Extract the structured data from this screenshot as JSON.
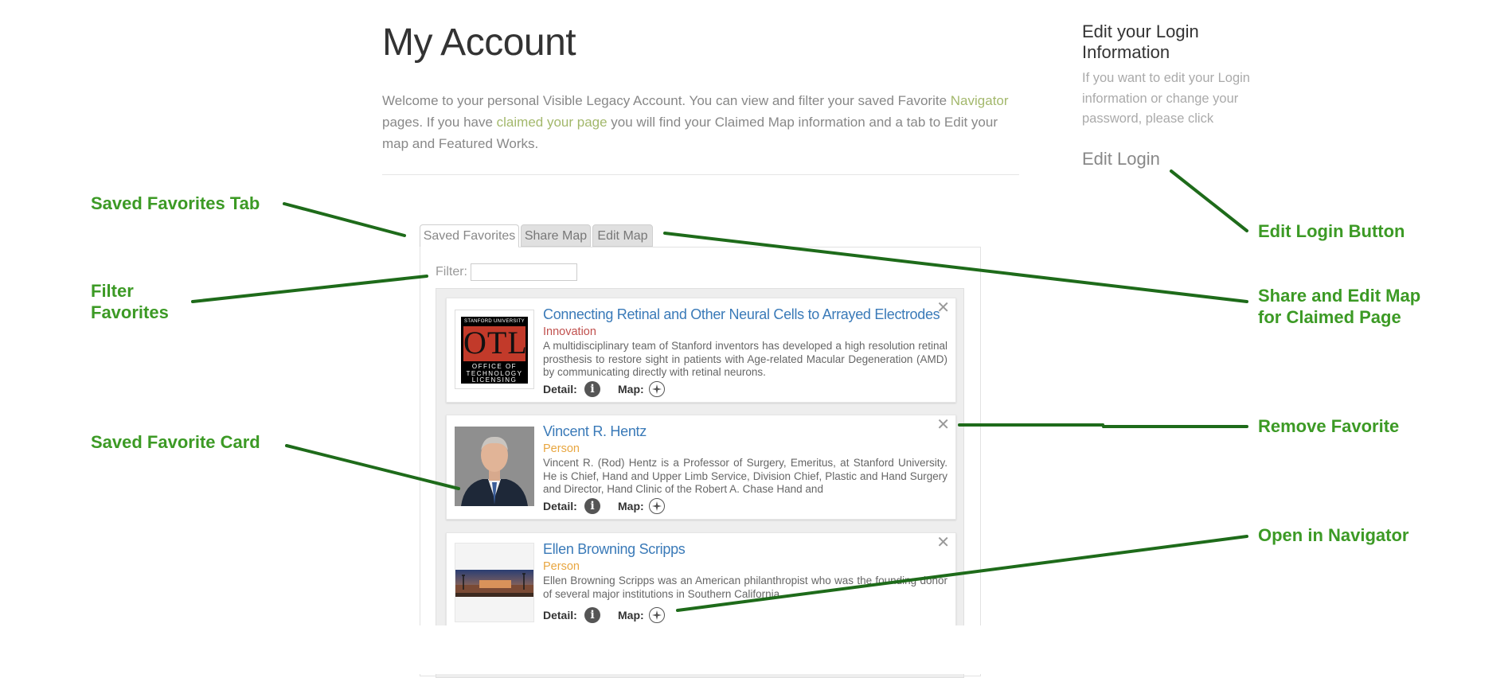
{
  "header": {
    "title": "My Account",
    "intro_part1": "Welcome to your personal Visible Legacy Account.  You can view and filter your saved Favorite ",
    "intro_link1": "Navigator",
    "intro_part2": " pages.  If you have ",
    "intro_link2": "claimed your page",
    "intro_part3": " you will find your Claimed Map information and a tab to Edit your map and Featured Works."
  },
  "sidebar": {
    "title": "Edit your Login Information",
    "text": "If you want to edit your Login information or change your password, please click",
    "edit_login": "Edit Login"
  },
  "tabs": [
    {
      "label": "Saved Favorites",
      "active": true
    },
    {
      "label": "Share Map",
      "active": false
    },
    {
      "label": "Edit Map",
      "active": false
    }
  ],
  "filter": {
    "label": "Filter:",
    "value": "",
    "placeholder": ""
  },
  "favorites": [
    {
      "title": "Connecting Retinal and Other Neural Cells to Arrayed Electrodes",
      "type": "Innovation",
      "type_color": "#c0504d",
      "description": "A multidisciplinary team of Stanford inventors has developed a high resolution retinal prosthesis to restore sight in patients with Age-related Macular Degeneration (AMD) by communicating directly with retinal neurons.",
      "thumb_text": {
        "top": "STANFORD UNIVERSITY",
        "logo": "OTL",
        "lines": [
          "OFFICE OF",
          "TECHNOLOGY",
          "LICENSING"
        ]
      },
      "detail_label": "Detail:",
      "map_label": "Map:"
    },
    {
      "title": "Vincent R. Hentz",
      "type": "Person",
      "type_color": "#e8a640",
      "description": "Vincent R. (Rod) Hentz is a Professor of Surgery, Emeritus, at Stanford University. He is Chief, Hand and Upper Limb Service, Division Chief, Plastic and Hand Surgery and Director, Hand Clinic of the Robert A. Chase Hand and",
      "detail_label": "Detail:",
      "map_label": "Map:"
    },
    {
      "title": "Ellen Browning Scripps",
      "type": "Person",
      "type_color": "#e8a640",
      "description": "Ellen Browning Scripps was an American philanthropist who was the founding donor of several major institutions in Southern California.",
      "detail_label": "Detail:",
      "map_label": "Map:"
    }
  ],
  "icons": {
    "info": "i",
    "close": "✕"
  },
  "annotations": {
    "saved_favorites_tab": "Saved Favorites Tab",
    "filter_favorites_1": "Filter",
    "filter_favorites_2": "Favorites",
    "saved_favorite_card": "Saved Favorite Card",
    "edit_login_button": "Edit Login Button",
    "share_edit_1": "Share and Edit Map",
    "share_edit_2": "for Claimed Page",
    "remove_favorite": "Remove Favorite",
    "open_navigator": "Open in Navigator",
    "color": "#3c9a25",
    "line_color": "#1e6b1a"
  }
}
